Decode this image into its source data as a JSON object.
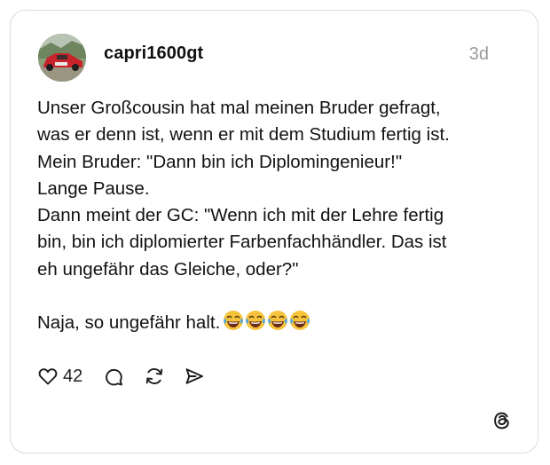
{
  "post": {
    "username": "capri1600gt",
    "timestamp": "3d",
    "avatar_icon": "car-photo-avatar",
    "lines": [
      "Unser Großcousin hat mal meinen Bruder gefragt,",
      "was er denn ist, wenn er mit dem Studium fertig ist.",
      "Mein Bruder: \"Dann bin ich Diplomingenieur!\"",
      "Lange Pause.",
      "Dann meint der GC: \"Wenn ich mit der Lehre fertig",
      "bin, bin ich diplomierter Farbenfachhändler. Das ist",
      "eh ungefähr das Gleiche, oder?\"",
      "",
      "Naja, so ungefähr halt."
    ],
    "emoji": "😂😂😂😂"
  },
  "actions": {
    "like_count": "42",
    "like_icon": "heart-icon",
    "comment_icon": "comment-icon",
    "repost_icon": "repost-icon",
    "share_icon": "share-icon"
  },
  "brand": {
    "logo_icon": "threads-logo-icon"
  }
}
